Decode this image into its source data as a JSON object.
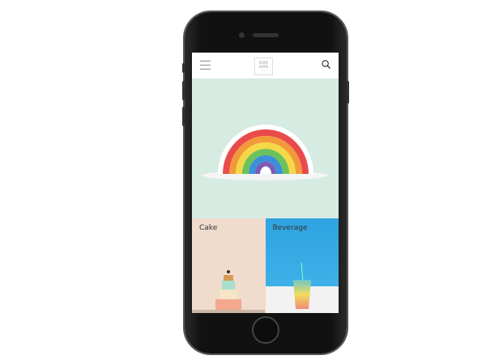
{
  "header": {
    "menu_icon": "hamburger-icon",
    "logo_text": "DORE DORE",
    "search_icon": "search-icon"
  },
  "hero": {
    "image": "rainbow-cake",
    "background": "#d6ebe1"
  },
  "categories": [
    {
      "label": "Cake"
    },
    {
      "label": "Beverage"
    }
  ]
}
